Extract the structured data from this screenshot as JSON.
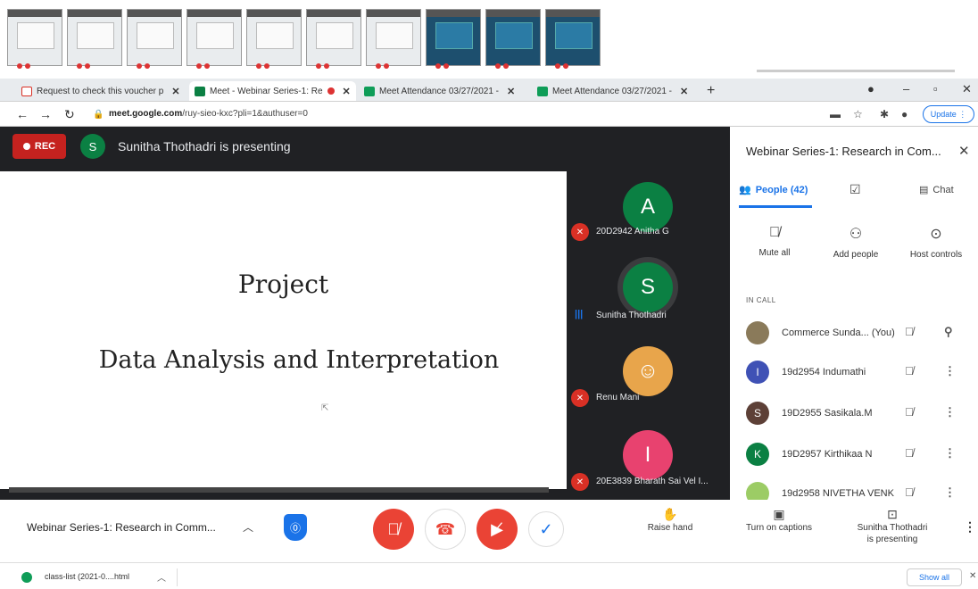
{
  "thumbnails": [
    "light",
    "light",
    "light",
    "light",
    "light",
    "light",
    "light",
    "teal",
    "teal",
    "teal"
  ],
  "tabs": [
    {
      "label": "Request to check this voucher p",
      "icon": "gmail-icon",
      "color": "#d93025"
    },
    {
      "label": "Meet - Webinar Series-1: Re",
      "icon": "meet-icon",
      "color": "#0b8043"
    },
    {
      "label": "Meet Attendance 03/27/2021 -",
      "icon": "sheets-icon",
      "color": "#0f9d58"
    },
    {
      "label": "Meet Attendance 03/27/2021 -",
      "icon": "sheets-icon",
      "color": "#0f9d58"
    }
  ],
  "address": {
    "url_bold": "meet.google.com",
    "url_rest": "/ruy-sieo-kxc?pli=1&authuser=0",
    "update_label": "Update"
  },
  "meet": {
    "rec_label": "REC",
    "presenter_initial": "S",
    "presenter_text": "Sunitha Thothadri is presenting",
    "slide_title": "Project",
    "slide_subtitle": "Data Analysis and Interpretation",
    "participants": [
      {
        "initial": "A",
        "name": "20D2942 Anitha G",
        "color": "#0b8043",
        "muted": true
      },
      {
        "initial": "S",
        "name": "Sunitha Thothadri",
        "color": "#0b8043",
        "muted": false
      },
      {
        "initial": "",
        "name": "Renu Mani",
        "color": "#e8a54b",
        "muted": true
      },
      {
        "initial": "I",
        "name": "20E3839 Bharath Sai Vel I...",
        "color": "#e8426f",
        "muted": true
      }
    ]
  },
  "panel": {
    "title": "Webinar Series-1: Research in Com...",
    "tabs": {
      "people": "People (42)",
      "chat": "Chat"
    },
    "actions": {
      "mute_all": "Mute all",
      "add_people": "Add people",
      "host_controls": "Host controls"
    },
    "in_call_label": "IN CALL",
    "people": [
      {
        "initial": "",
        "name": "Commerce Sunda... (You)",
        "color": "#8a7a5a"
      },
      {
        "initial": "I",
        "name": "19d2954 Indumathi",
        "color": "#3f51b5"
      },
      {
        "initial": "S",
        "name": "19D2955 Sasikala.M",
        "color": "#5d4037"
      },
      {
        "initial": "K",
        "name": "19D2957 Kirthikaa N",
        "color": "#0b8043"
      },
      {
        "initial": "",
        "name": "19d2958 NIVETHA VENK",
        "color": "#9ccc65"
      }
    ]
  },
  "bottom": {
    "meeting_name": "Webinar Series-1: Research in Comm...",
    "raise_hand": "Raise hand",
    "captions": "Turn on captions",
    "presenting_line1": "Sunitha Thothadri",
    "presenting_line2": "is presenting"
  },
  "downloads": {
    "file": "class-list (2021-0....html",
    "show_all": "Show all"
  }
}
